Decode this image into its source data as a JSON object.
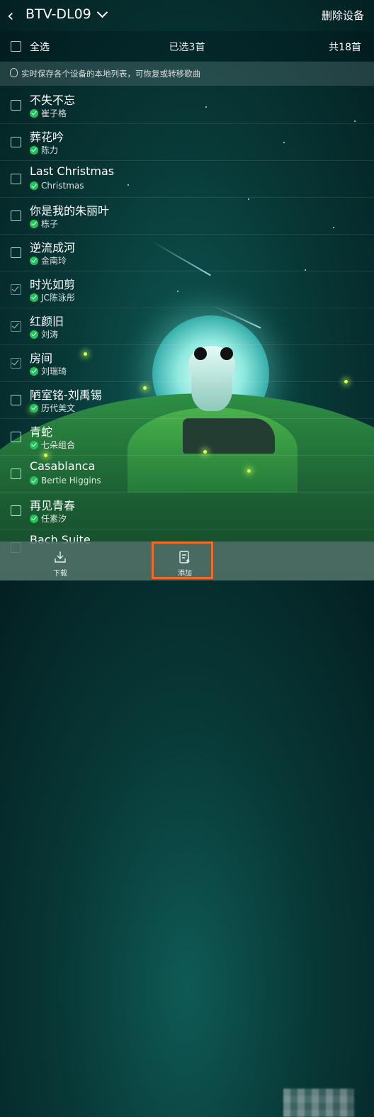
{
  "header": {
    "back_icon": "chevron-left-icon",
    "title": "BTV-DL09",
    "delete_label": "删除设备"
  },
  "selection": {
    "select_all_label": "全选",
    "selected_count_label": "已选3首",
    "total_label": "共18首"
  },
  "tip": {
    "icon": "lightbulb-icon",
    "text": "实时保存各个设备的本地列表，可恢复或转移歌曲"
  },
  "songs": [
    {
      "title": "不失不忘",
      "artist": "崔子格",
      "checked": false
    },
    {
      "title": "葬花吟",
      "artist": "陈力",
      "checked": false
    },
    {
      "title": "Last Christmas",
      "artist": "Christmas",
      "checked": false
    },
    {
      "title": "你是我的朱丽叶",
      "artist": "栋子",
      "checked": false
    },
    {
      "title": "逆流成河",
      "artist": "金南玲",
      "checked": false
    },
    {
      "title": "时光如剪",
      "artist": "JC陈泳彤",
      "checked": true
    },
    {
      "title": "红颜旧",
      "artist": "刘涛",
      "checked": true
    },
    {
      "title": "房间",
      "artist": "刘瑞琦",
      "checked": true
    },
    {
      "title": "陋室铭-刘禹锡",
      "artist": "历代美文",
      "checked": false
    },
    {
      "title": "青蛇",
      "artist": "七朵组合",
      "checked": false
    },
    {
      "title": "Casablanca",
      "artist": "Bertie Higgins",
      "checked": false
    },
    {
      "title": "再见青春",
      "artist": "任素汐",
      "checked": false
    },
    {
      "title": "Bach Suite",
      "artist": "",
      "checked": false
    }
  ],
  "toolbar": {
    "download_label": "下载",
    "add_label": "添加",
    "highlight_color": "#f06a2a"
  },
  "colors": {
    "downloaded_badge": "#21c45a"
  }
}
